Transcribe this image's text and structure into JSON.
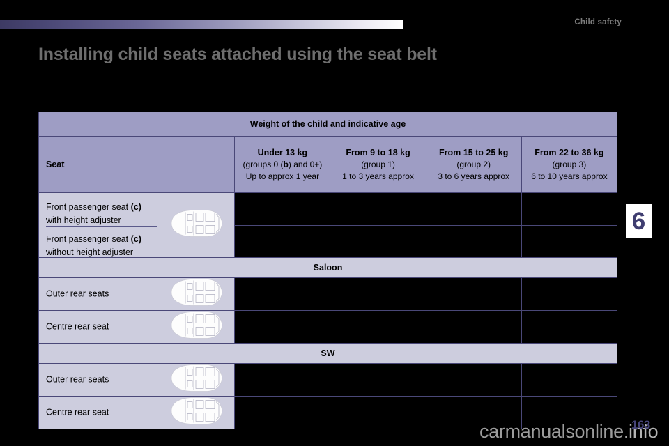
{
  "header": {
    "chapter_label": "Child safety",
    "chapter_number": "6"
  },
  "page_title": "Installing child seats attached using the seat belt",
  "table": {
    "top_header": "Weight of the child and indicative age",
    "seat_header": "Seat",
    "weight_columns": [
      {
        "weight": "Under 13 kg",
        "group": "(groups 0 (b) and 0+)",
        "age": "Up to approx 1 year"
      },
      {
        "weight": "From 9 to 18 kg",
        "group": "(group 1)",
        "age": "1 to 3 years approx"
      },
      {
        "weight": "From 15 to 25 kg",
        "group": "(group 2)",
        "age": "3 to 6 years approx"
      },
      {
        "weight": "From 22 to 36 kg",
        "group": "(group 3)",
        "age": "6 to 10 years approx"
      }
    ],
    "front_rows": {
      "line1a": "Front passenger seat (c)",
      "line1b": "with height adjuster",
      "line2a": "Front passenger seat (c)",
      "line2b": "without height adjuster"
    },
    "sections": [
      {
        "title": "Saloon",
        "rows": [
          {
            "label": "Outer rear seats"
          },
          {
            "label": "Centre rear seat"
          }
        ]
      },
      {
        "title": "SW",
        "rows": [
          {
            "label": "Outer rear seats"
          },
          {
            "label": "Centre rear seat"
          }
        ]
      }
    ]
  },
  "footer": {
    "watermark": "carmanualsonline",
    "watermark_suffix": ".info",
    "page_number": "163"
  },
  "colors": {
    "header_band": "#9e9dc4",
    "row_band": "#cdcdde",
    "border": "#4a4878",
    "data_cell": "#000000",
    "accent": "#46447a",
    "title_text": "#6e6e6e"
  }
}
